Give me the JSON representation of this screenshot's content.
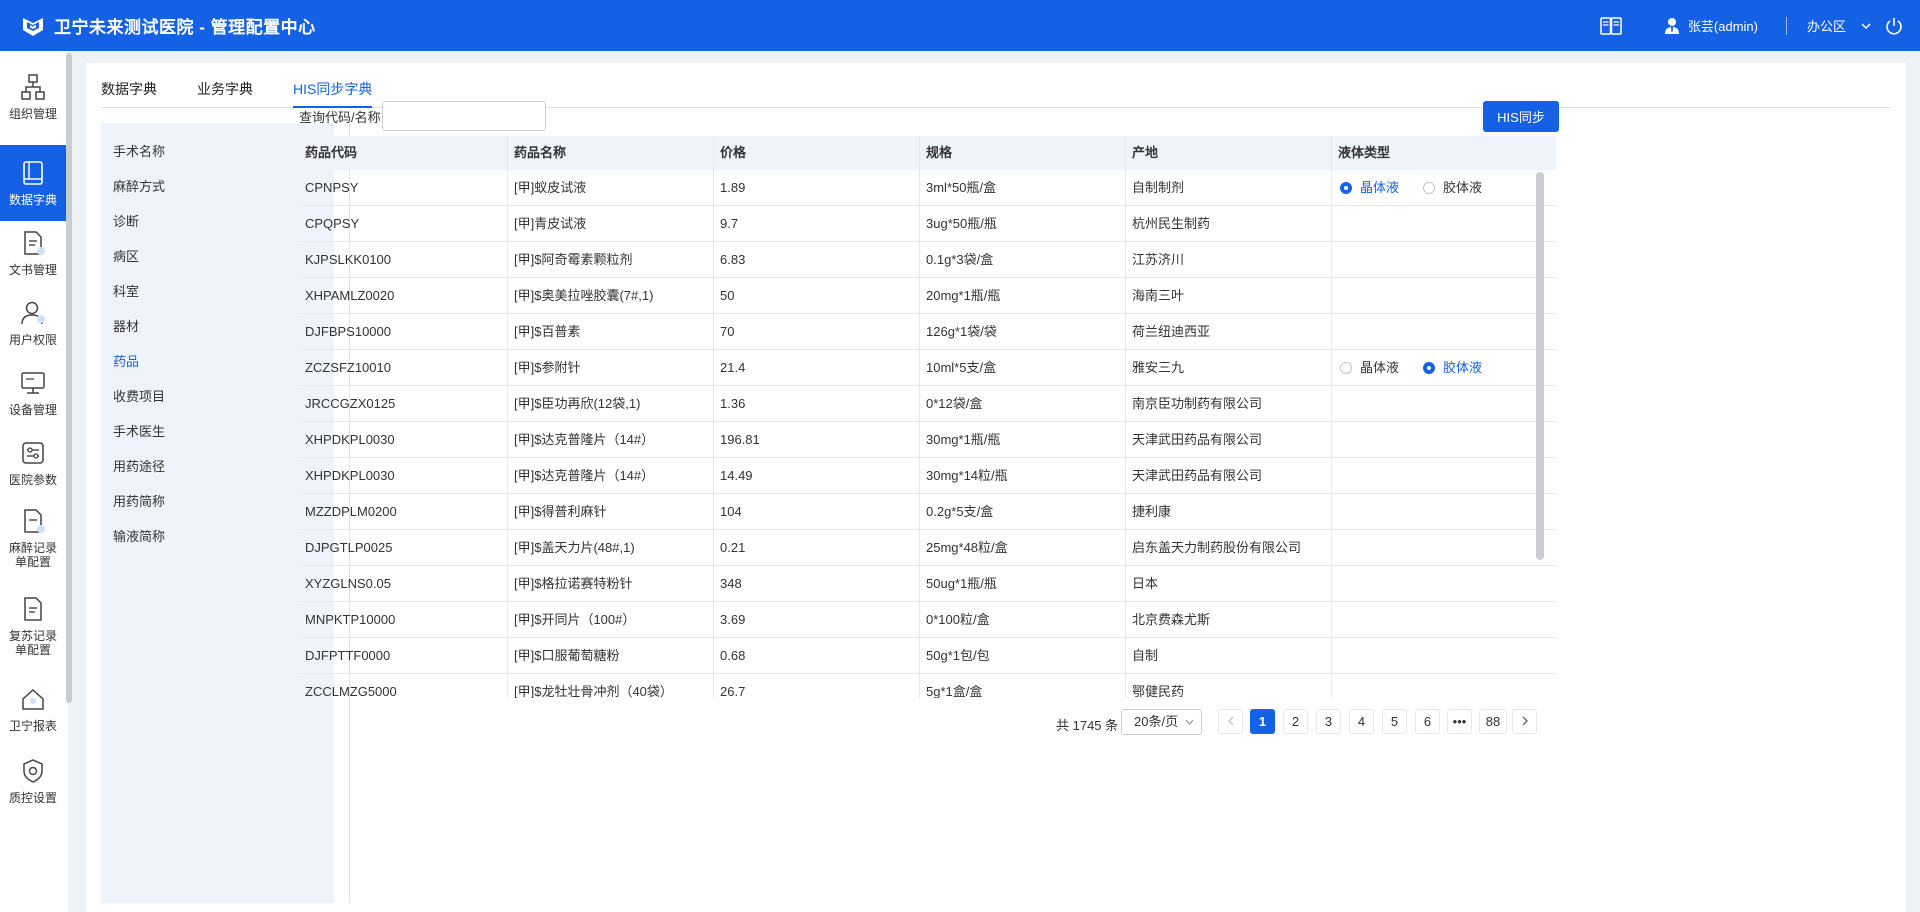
{
  "header": {
    "title": "卫宁未来测试医院 - 管理配置中心",
    "user": "张芸(admin)",
    "office": "办公区"
  },
  "sidenav": [
    {
      "label": "组织管理",
      "icon": "org-structure-icon"
    },
    {
      "label": "数据字典",
      "icon": "book-icon",
      "active": true
    },
    {
      "label": "文书管理",
      "icon": "document-icon"
    },
    {
      "label": "用户权限",
      "icon": "user-permission-icon"
    },
    {
      "label": "设备管理",
      "icon": "monitor-icon"
    },
    {
      "label": "医院参数",
      "icon": "settings-panel-icon"
    },
    {
      "label": "麻醉记录单配置",
      "icon": "anesthesia-record-icon"
    },
    {
      "label": "复苏记录单配置",
      "icon": "recovery-record-icon"
    },
    {
      "label": "卫宁报表",
      "icon": "report-icon"
    },
    {
      "label": "质控设置",
      "icon": "quality-shield-icon"
    }
  ],
  "tabs": [
    "数据字典",
    "业务字典",
    "HIS同步字典"
  ],
  "active_tab": 2,
  "sublist": [
    "手术名称",
    "麻醉方式",
    "诊断",
    "病区",
    "科室",
    "器材",
    "药品",
    "收费项目",
    "手术医生",
    "用药途径",
    "用药简称",
    "输液简称"
  ],
  "active_sub": 6,
  "query": {
    "label": "查询代码/名称",
    "value": ""
  },
  "sync_button": "HIS同步",
  "table": {
    "columns": [
      "药品代码",
      "药品名称",
      "价格",
      "规格",
      "产地",
      "液体类型"
    ],
    "liquid_options": [
      "晶体液",
      "胶体液"
    ],
    "rows": [
      {
        "code": "CPNPSY",
        "name": "[甲]蚁皮试液",
        "price": "1.89",
        "spec": "3ml*50瓶/盒",
        "origin": "自制制剂",
        "liquid": "晶体液"
      },
      {
        "code": "CPQPSY",
        "name": "[甲]青皮试液",
        "price": "9.7",
        "spec": "3ug*50瓶/瓶",
        "origin": "杭州民生制药",
        "liquid": ""
      },
      {
        "code": "KJPSLKK0100",
        "name": "[甲]$阿奇霉素颗粒剂",
        "price": "6.83",
        "spec": "0.1g*3袋/盒",
        "origin": "江苏济川",
        "liquid": ""
      },
      {
        "code": "XHPAMLZ0020",
        "name": "[甲]$奥美拉唑胶囊(7#,1)",
        "price": "50",
        "spec": "20mg*1瓶/瓶",
        "origin": "海南三叶",
        "liquid": ""
      },
      {
        "code": "DJFBPS10000",
        "name": "[甲]$百普素",
        "price": "70",
        "spec": "126g*1袋/袋",
        "origin": "荷兰纽迪西亚",
        "liquid": ""
      },
      {
        "code": "ZCZSFZ10010",
        "name": "[甲]$参附针",
        "price": "21.4",
        "spec": "10ml*5支/盒",
        "origin": "雅安三九",
        "liquid": "胶体液"
      },
      {
        "code": "JRCCGZX0125",
        "name": "[甲]$臣功再欣(12袋,1)",
        "price": "1.36",
        "spec": "0*12袋/盒",
        "origin": "南京臣功制药有限公司",
        "liquid": ""
      },
      {
        "code": "XHPDKPL0030",
        "name": "[甲]$达克普隆片（14#）",
        "price": "196.81",
        "spec": "30mg*1瓶/瓶",
        "origin": "天津武田药品有限公司",
        "liquid": ""
      },
      {
        "code": "XHPDKPL0030",
        "name": "[甲]$达克普隆片（14#）",
        "price": "14.49",
        "spec": "30mg*14粒/瓶",
        "origin": "天津武田药品有限公司",
        "liquid": ""
      },
      {
        "code": "MZZDPLM0200",
        "name": "[甲]$得普利麻针",
        "price": "104",
        "spec": "0.2g*5支/盒",
        "origin": "捷利康",
        "liquid": ""
      },
      {
        "code": "DJPGTLP0025",
        "name": "[甲]$盖天力片(48#,1)",
        "price": "0.21",
        "spec": "25mg*48粒/盒",
        "origin": "启东盖天力制药股份有限公司",
        "liquid": ""
      },
      {
        "code": "XYZGLNS0.05",
        "name": "[甲]$格拉诺赛特粉针",
        "price": "348",
        "spec": "50ug*1瓶/瓶",
        "origin": "日本",
        "liquid": ""
      },
      {
        "code": "MNPKTP10000",
        "name": "[甲]$开同片（100#）",
        "price": "3.69",
        "spec": "0*100粒/盒",
        "origin": "北京费森尤斯",
        "liquid": ""
      },
      {
        "code": "DJFPTTF0000",
        "name": "[甲]$口服葡萄糖粉",
        "price": "0.68",
        "spec": "50g*1包/包",
        "origin": "自制",
        "liquid": ""
      },
      {
        "code": "ZCCLMZG5000",
        "name": "[甲]$龙牡壮骨冲剂（40袋）",
        "price": "26.7",
        "spec": "5g*1盒/盒",
        "origin": "鄂健民药",
        "liquid": ""
      }
    ]
  },
  "pagination": {
    "total": "共 1745 条",
    "page_size": "20条/页",
    "pages": [
      "1",
      "2",
      "3",
      "4",
      "5",
      "6",
      "•••",
      "88"
    ],
    "current": "1"
  }
}
